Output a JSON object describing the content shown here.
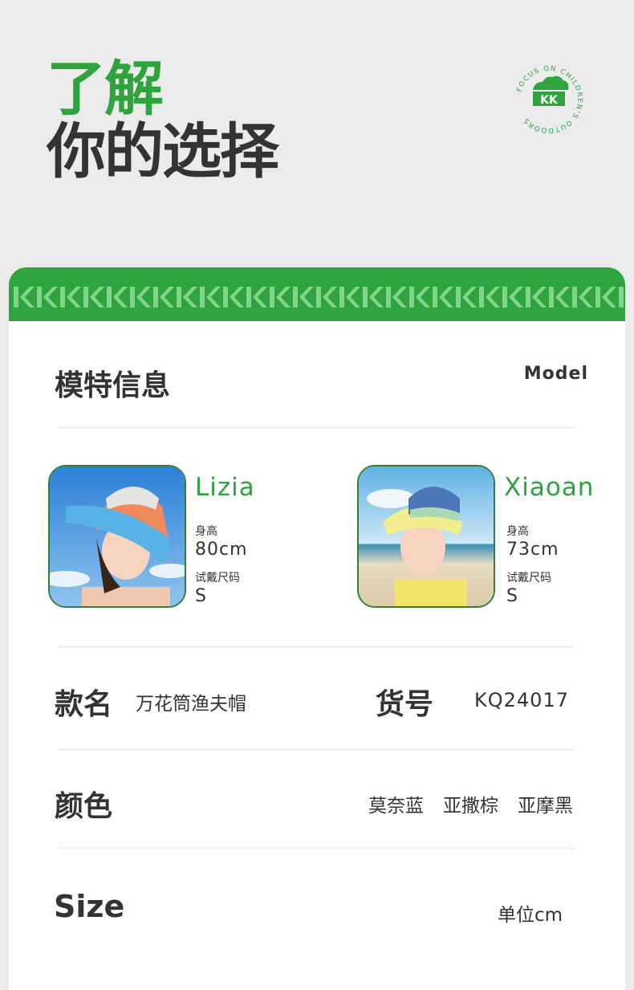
{
  "header": {
    "line1": "了解",
    "line2": "你的选择",
    "logo": {
      "badge": "KK",
      "ring_text": "FOCUS ON CHILDREN'S OUTDOORS"
    }
  },
  "card": {
    "model_section": {
      "title": "模特信息",
      "title_en": "Model"
    },
    "models": [
      {
        "name": "Lizia",
        "height_label": "身高",
        "height": "80cm",
        "size_label": "试戴尺码",
        "size": "S"
      },
      {
        "name": "Xiaoan",
        "height_label": "身高",
        "height": "73cm",
        "size_label": "试戴尺码",
        "size": "S"
      }
    ],
    "product": {
      "name_label": "款名",
      "name": "万花筒渔夫帽",
      "sku_label": "货号",
      "sku": "KQ24017"
    },
    "color": {
      "label": "颜色",
      "options": [
        "莫奈蓝",
        "亚撒棕",
        "亚摩黑"
      ]
    },
    "size": {
      "label": "Size",
      "unit": "单位cm"
    }
  },
  "colors": {
    "brand_green": "#2fa33e",
    "text_dark": "#333333",
    "background": "#ebebeb"
  }
}
